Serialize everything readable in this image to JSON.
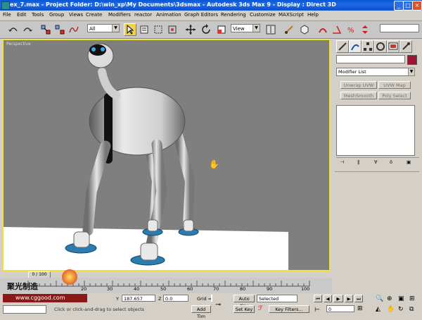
{
  "window": {
    "title": "ex_7.max    - Project Folder: D:\\win_xp\\My Documents\\3dsmax    - Autodesk 3ds Max 9    - Display : Direct 3D",
    "buttons": [
      "_",
      "□",
      "×"
    ]
  },
  "menu": [
    "File",
    "Edit",
    "Tools",
    "Group",
    "Views",
    "Create",
    "Modifiers",
    "reactor",
    "Animation",
    "Graph Editors",
    "Rendering",
    "Customize",
    "MAXScript",
    "Help"
  ],
  "toolbar": {
    "selection_filter": "All",
    "ref_coord": "View"
  },
  "viewport": {
    "label": "Perspective"
  },
  "command_panel": {
    "modifier_list": "Modifier List",
    "buttons": [
      "Unwrap UVW",
      "UVW Map",
      "MeshSmooth",
      "Poly Select"
    ]
  },
  "timeline": {
    "slider_label": "0 / 100",
    "ticks": [
      "20",
      "30",
      "40",
      "50",
      "60",
      "70",
      "80",
      "90",
      "100"
    ]
  },
  "status": {
    "y_label": "Y",
    "y_value": "187.657",
    "z_label": "Z",
    "z_value": "0.0",
    "grid_label": "Grid =",
    "auto_key": "Auto Key",
    "selected": "Selected",
    "set_key": "Set Key",
    "key_filters": "Key Filters...",
    "add_time": "Add Tim",
    "prompt": "Click or click-and-drag to select objects",
    "frame": "0"
  },
  "watermark": {
    "cn": "聚光制造",
    "url": "www.cggood.com"
  },
  "colors": {
    "titlebar": "#0a58d6",
    "viewport_bg": "#7f7f7f",
    "viewport_border": "#f3e23a",
    "object_color": "#9b1535"
  }
}
